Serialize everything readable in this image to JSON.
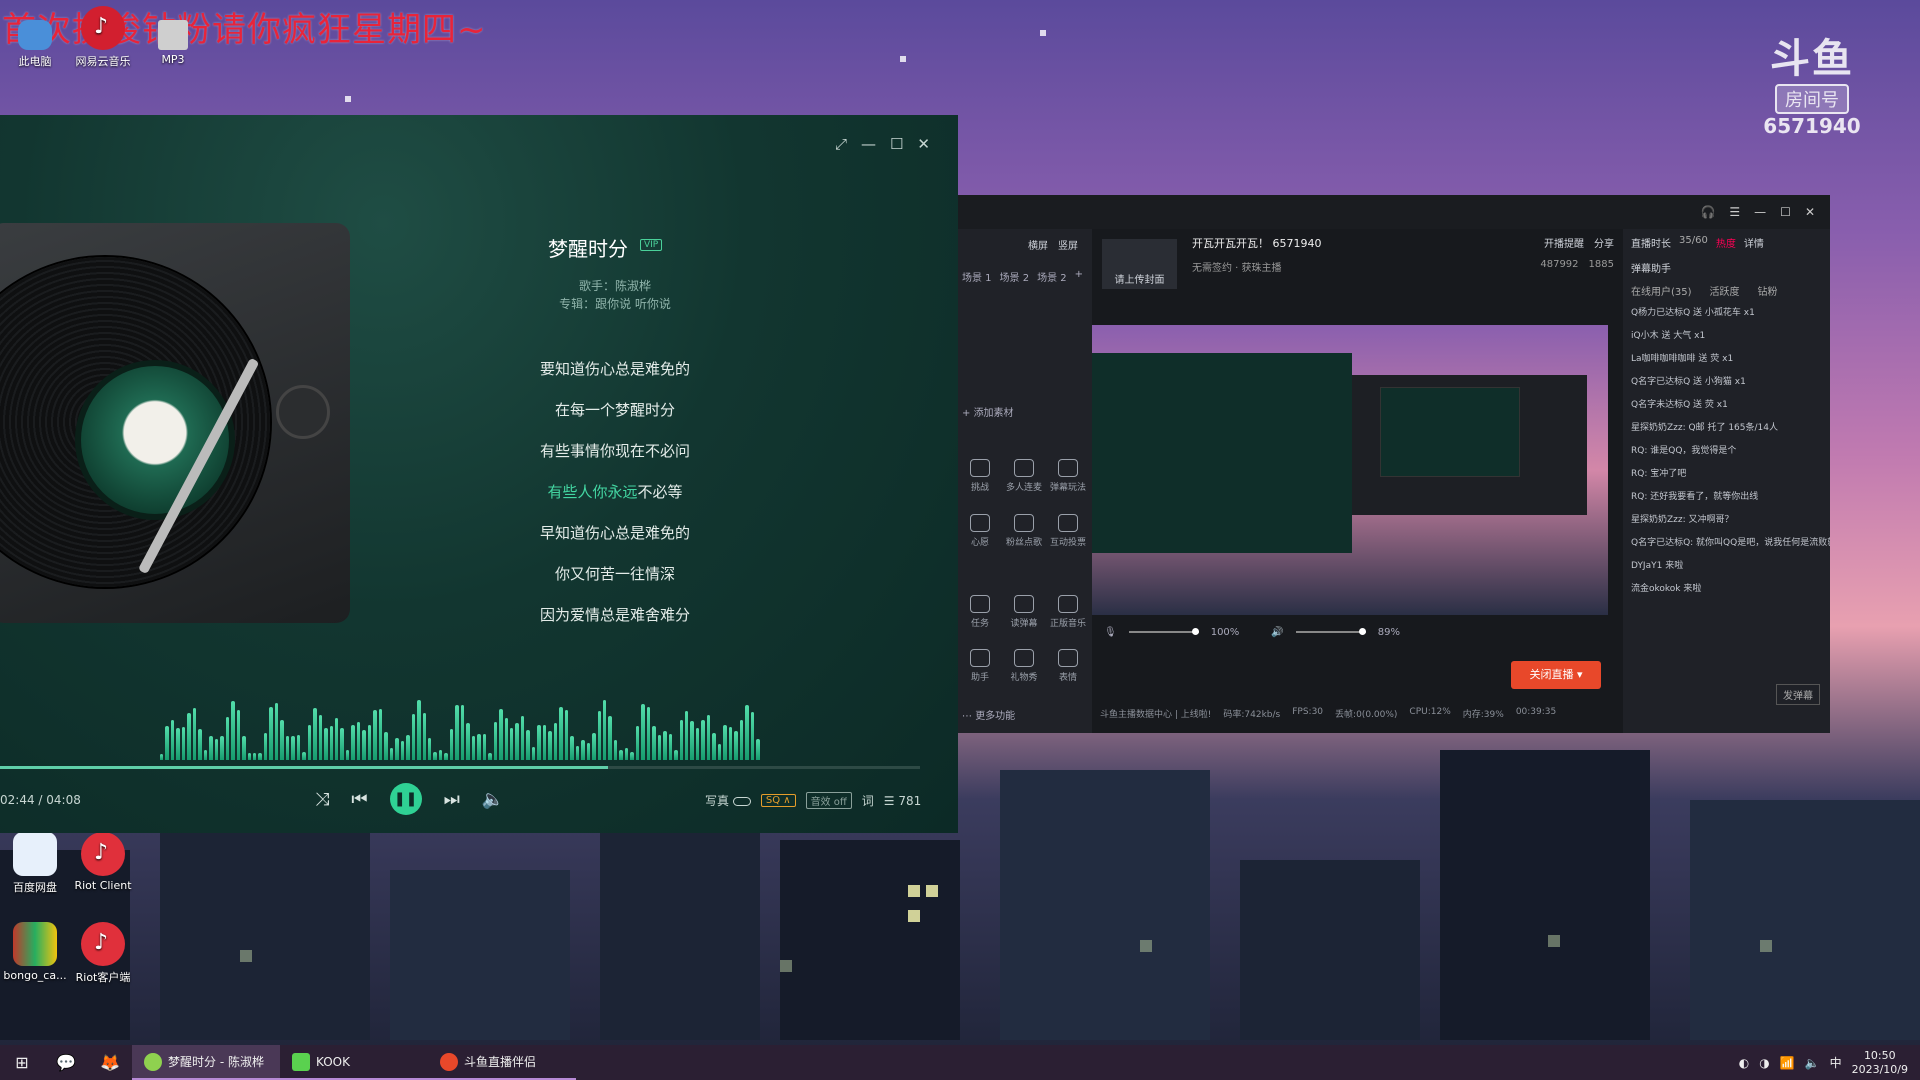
{
  "banner": "首次挑唆钻粉请你疯狂星期四~",
  "desktop": {
    "top_icons": [
      {
        "label": "此电脑"
      },
      {
        "label": "网易云音乐"
      },
      {
        "label": "MP3"
      }
    ],
    "bottom_icons": [
      {
        "label": "百度网盘"
      },
      {
        "label": "Riot Client"
      },
      {
        "label": "bongo_ca..."
      },
      {
        "label": "Riot客户端"
      }
    ]
  },
  "douyu_watermark": {
    "logo": "斗鱼",
    "tag": "房间号",
    "room": "6571940"
  },
  "player": {
    "title": "梦醒时分",
    "vip": "VIP",
    "singer": "歌手：陈淑桦",
    "album": "专辑：跟你说 听你说",
    "lyrics": [
      {
        "text": "要知道伤心总是难免的",
        "hl": ""
      },
      {
        "text": "在每一个梦醒时分",
        "hl": ""
      },
      {
        "text": "有些事情你现在不必问",
        "hl": ""
      },
      {
        "text": "不必等",
        "hl": "有些人你永远"
      },
      {
        "text": "早知道伤心总是难免的",
        "hl": ""
      },
      {
        "text": "你又何苦一往情深",
        "hl": ""
      },
      {
        "text": "因为爱情总是难舍难分",
        "hl": ""
      }
    ],
    "time": "02:44 / 04:08",
    "progress": 0.661,
    "controls": {
      "shuffle": "⤨",
      "prev": "⏮",
      "play": "❚❚",
      "next": "⏭",
      "volume": "🔈"
    },
    "right": {
      "write": "写真",
      "quality": "SQ ∧",
      "effect": "音效 off",
      "lyric_icon": "词",
      "playlist_count": "781"
    }
  },
  "stream": {
    "tabs": [
      "横屏",
      "竖屏"
    ],
    "scenes": [
      "场景 1",
      "场景 2",
      "场景 2"
    ],
    "cover_label": "请上传封面",
    "room_title": "开瓦开瓦开瓦！",
    "room_id": "6571940",
    "contract": "无需签约 · 获珠主播",
    "start_notify": "开播提醒",
    "share": "分享",
    "stat1": "487992",
    "stat2": "1885",
    "add_material": "添加素材",
    "tools": [
      {
        "label": "挑战"
      },
      {
        "label": "多人连麦"
      },
      {
        "label": "弹幕玩法"
      },
      {
        "label": "心愿"
      },
      {
        "label": "粉丝点歌"
      },
      {
        "label": "互动投票"
      },
      {
        "label": "任务"
      },
      {
        "label": "读弹幕"
      },
      {
        "label": "正版音乐"
      },
      {
        "label": "助手"
      },
      {
        "label": "礼物秀"
      },
      {
        "label": "表情"
      }
    ],
    "more": "更多功能",
    "mic_volume": "100%",
    "speaker_volume": "89%",
    "close_live": "关闭直播",
    "status": [
      "斗鱼主播数据中心 | 上线啦!",
      "码率:742kb/s",
      "FPS:30",
      "丢帧:0(0.00%)",
      "CPU:12%",
      "内存:39%",
      "00:39:35"
    ],
    "live_time_label": "直播时长",
    "live_time_val": "35/60",
    "hot": "热度",
    "detail": "详情",
    "assistant": "弹幕助手",
    "right_tabs": [
      "在线用户(35)",
      "活跃度",
      "钻粉"
    ],
    "gifts": [
      "Q杨力已达标Q 送 小孤花车 x1",
      "iQ小木 送 大气 x1",
      "La咖啡咖啡咖啡 送 荧 x1",
      "Q名字已达标Q 送 小狗猫 x1",
      "Q名字未达标Q 送 荧 x1"
    ],
    "chat": [
      "星探奶奶Zzz: Q邮 托了 165条/14人",
      "RQ: 谁是QQ，我觉得是个",
      "RQ: 宝冲了吧",
      "RQ: 还好我要看了，就等你出线",
      "星探奶奶Zzz: 又冲啊哥？",
      "Q名字已达标Q: 就你叫QQ是吧，说我任何是流败就发?",
      "DYJaY1 来啦",
      "流金okokok 来啦"
    ],
    "input_btn": "发弹幕"
  },
  "taskbar": {
    "apps": [
      {
        "label": "梦醒时分 - 陈淑桦"
      },
      {
        "label": "KOOK"
      },
      {
        "label": "斗鱼直播伴侣"
      }
    ],
    "time": "10:50",
    "date": "2023/10/9",
    "ime": "中"
  }
}
